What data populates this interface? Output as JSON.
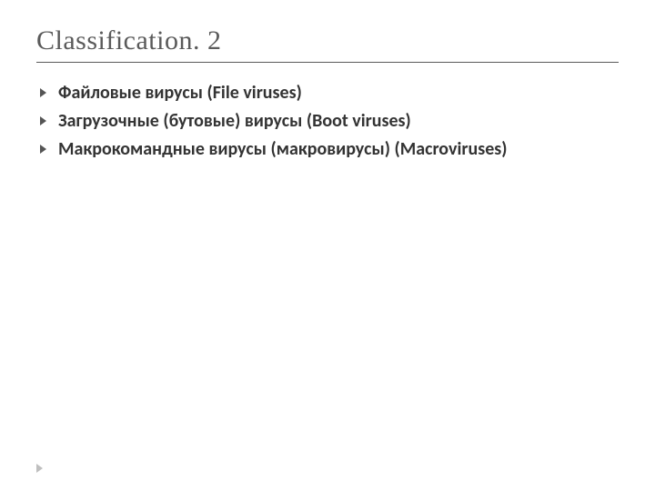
{
  "title": "Classification. 2",
  "items": [
    "Файловые вирусы (File viruses)",
    "Загрузочные (бутовые) вирусы (Boot viruses)",
    "Макрокомандные вирусы (макровирусы) (Macroviruses)"
  ]
}
